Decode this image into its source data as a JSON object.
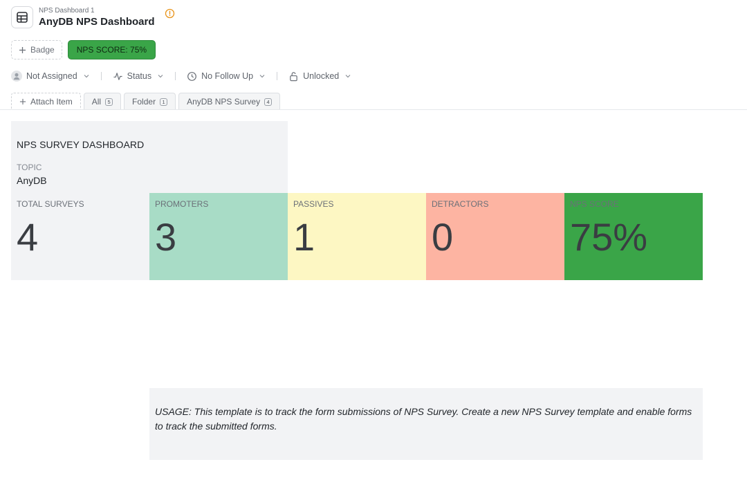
{
  "header": {
    "breadcrumb": "NPS Dashboard 1",
    "title": "AnyDB NPS Dashboard",
    "app_icon": "table-icon",
    "warning_icon": "alert-circle-icon",
    "warning_color": "#e8941a"
  },
  "badges": {
    "add_label": "Badge",
    "nps_label": "NPS SCORE: 75%",
    "nps_color": "#3aa548"
  },
  "status_bar": {
    "assignee": "Not Assigned",
    "status": "Status",
    "follow_up": "No Follow Up",
    "lock": "Unlocked"
  },
  "tabs": {
    "attach_label": "Attach Item",
    "items": [
      {
        "label": "All",
        "count": "5"
      },
      {
        "label": "Folder",
        "count": "1"
      },
      {
        "label": "AnyDB NPS Survey",
        "count": "4"
      }
    ]
  },
  "dashboard": {
    "title": "NPS SURVEY DASHBOARD",
    "topic_label": "TOPIC",
    "topic_value": "AnyDB",
    "cards": [
      {
        "label": "TOTAL SURVEYS",
        "value": "4",
        "color": "#f2f3f5"
      },
      {
        "label": "PROMOTERS",
        "value": "3",
        "color": "#a8dcc6"
      },
      {
        "label": "PASSIVES",
        "value": "1",
        "color": "#fdf7c3"
      },
      {
        "label": "DETRACTORS",
        "value": "0",
        "color": "#fdb4a2"
      },
      {
        "label": "NPS SCORE",
        "value": "75%",
        "color": "#3aa548"
      }
    ],
    "usage": "USAGE: This template is to track the form submissions of NPS Survey. Create a new NPS Survey template and enable forms to track the submitted forms."
  }
}
